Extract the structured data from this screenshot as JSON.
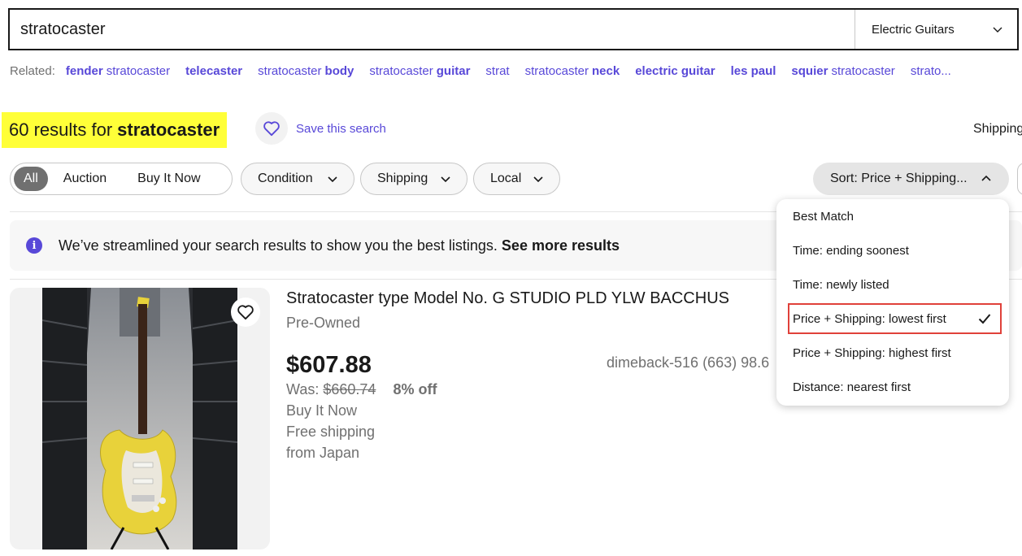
{
  "search": {
    "query": "stratocaster",
    "category": "Electric Guitars"
  },
  "related": {
    "label": "Related:",
    "links": [
      {
        "bold": "fender",
        "light": "stratocaster",
        "order": "bold-first"
      },
      {
        "bold": "telecaster",
        "light": ""
      },
      {
        "light": "stratocaster",
        "bold": "body",
        "order": "light-first"
      },
      {
        "light": "stratocaster",
        "bold": "guitar",
        "order": "light-first"
      },
      {
        "light": "strat",
        "bold": ""
      },
      {
        "light": "stratocaster",
        "bold": "neck",
        "order": "light-first"
      },
      {
        "bold": "electric guitar",
        "light": ""
      },
      {
        "bold": "les paul",
        "light": ""
      },
      {
        "bold": "squier",
        "light": "stratocaster",
        "order": "bold-first"
      },
      {
        "light": "strato...",
        "bold": ""
      }
    ]
  },
  "results": {
    "count_text": "60 results for",
    "query_text": "stratocaster",
    "save_label": "Save this search",
    "shipping_label": "Shipping"
  },
  "filters": {
    "segments": [
      "All",
      "Auction",
      "Buy It Now"
    ],
    "active_segment": "All",
    "condition": "Condition",
    "shipping": "Shipping",
    "local": "Local",
    "sort": "Sort: Price + Shipping..."
  },
  "banner": {
    "text": "We’ve streamlined your search results to show you the best listings.",
    "link": "See more results"
  },
  "listing": {
    "title": "Stratocaster type Model No. G STUDIO PLD YLW BACCHUS",
    "condition": "Pre-Owned",
    "price": "$607.88",
    "was_label": "Was:",
    "was_price": "$660.74",
    "discount": "8% off",
    "format": "Buy It Now",
    "shipping": "Free shipping",
    "origin": "from Japan",
    "seller": "dimeback-516 (663) 98.6"
  },
  "sort_menu": {
    "items": [
      "Best Match",
      "Time: ending soonest",
      "Time: newly listed",
      "Price + Shipping: lowest first",
      "Price + Shipping: highest first",
      "Distance: nearest first"
    ],
    "selected": "Price + Shipping: lowest first"
  },
  "colors": {
    "accent": "#5848d8",
    "highlight": "#ffff38",
    "annotation": "#e0413a"
  }
}
